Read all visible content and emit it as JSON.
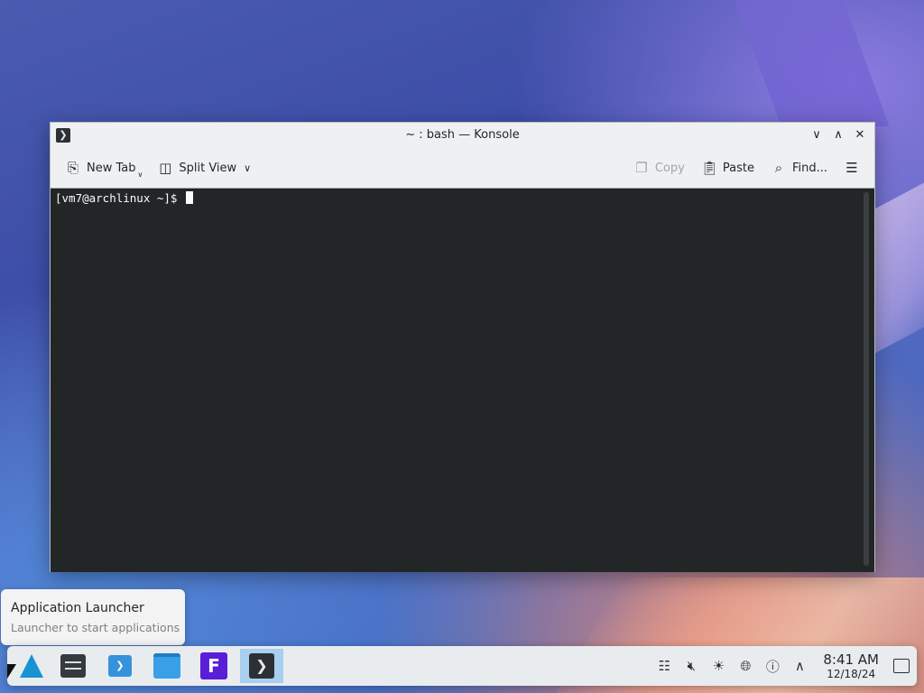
{
  "window": {
    "title": "~ : bash — Konsole",
    "app_icon": "konsole-icon",
    "controls": [
      "minimize-icon",
      "maximize-icon",
      "close-icon"
    ]
  },
  "toolbar": {
    "new_tab": "New Tab",
    "split_view": "Split View",
    "copy": "Copy",
    "paste": "Paste",
    "find": "Find...",
    "menu_icon": "hamburger-icon"
  },
  "terminal": {
    "prompt": "[vm7@archlinux ~]$"
  },
  "tooltip": {
    "title": "Application Launcher",
    "subtitle": "Launcher to start applications"
  },
  "taskbar": {
    "apps": [
      "arch-launcher-icon",
      "system-settings-icon",
      "discover-icon",
      "dolphin-files-icon",
      "firefox-icon",
      "konsole-icon"
    ],
    "tray": [
      "clipboard-icon",
      "volume-muted-icon",
      "brightness-icon",
      "network-icon",
      "update-icon",
      "chevron-up-icon"
    ],
    "time": "8:41 AM",
    "date": "12/18/24"
  }
}
